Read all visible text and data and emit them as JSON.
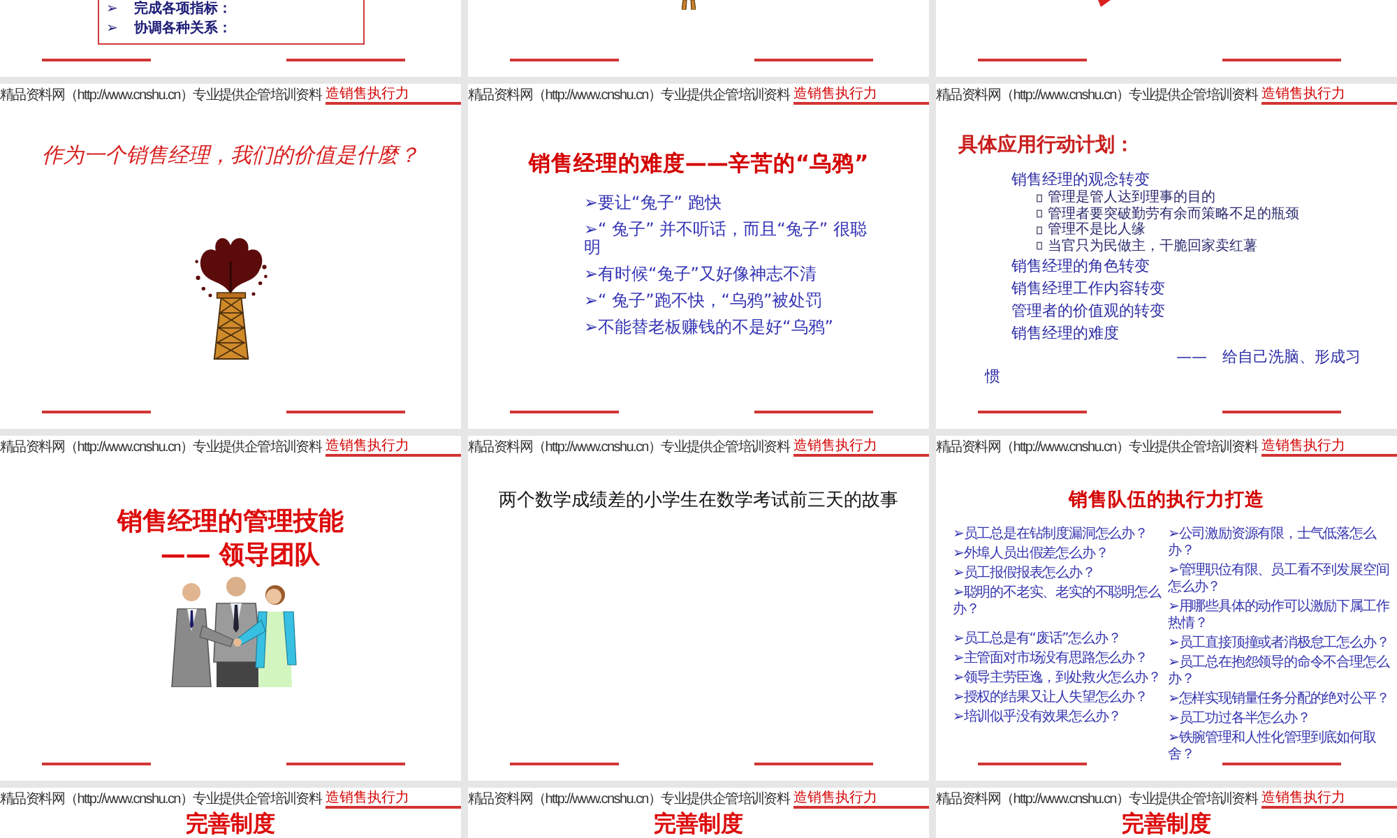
{
  "rows": [
    {
      "slides": [
        {
          "kind": "boxed-list",
          "items": [
            {
              "bullet": "➢",
              "text": "完成各项指标："
            },
            {
              "bullet": "➢",
              "text": "协调各种关系："
            }
          ]
        },
        {
          "kind": "tower-fragment"
        },
        {
          "kind": "arrow-fragment"
        }
      ]
    },
    {
      "slides": [
        {
          "kind": "question",
          "header": {
            "site": "精品资料网（http://www.cnshu.cn）专业提供企管培训资料",
            "topic": "造销售执行力"
          },
          "title": "作为一个销售经理，我们的价值是什麼？"
        },
        {
          "kind": "bullets",
          "header": {
            "site": "精品资料网（http://www.cnshu.cn）专业提供企管培训资料",
            "topic": "造销售执行力"
          },
          "title": "销售经理的难度——辛苦的“乌鸦”",
          "items": [
            "➢要让“兔子” 跑快",
            "➢“ 兔子” 并不听话，而且“兔子” 很聪明",
            "➢有时候“兔子”又好像神志不清",
            "➢“ 兔子”跑不快，“乌鸦”被处罚",
            "➢不能替老板赚钱的不是好“乌鸦”"
          ]
        },
        {
          "kind": "plan",
          "header": {
            "site": "精品资料网（http://www.cnshu.cn）专业提供企管培训资料",
            "topic": "造销售执行力"
          },
          "title": "具体应用行动计划：",
          "items": [
            {
              "text": "销售经理的观念转变",
              "children": [
                {
                  "text": "管理是管人达到理事的目的"
                },
                {
                  "text": "管理者要突破勤劳有余而策略不足的瓶颈"
                },
                {
                  "text": "管理不是比人缘"
                },
                {
                  "text": "当官只为民做主，干脆回家卖红薯"
                }
              ]
            },
            {
              "text": "销售经理的角色转变"
            },
            {
              "text": "销售经理工作内容转变"
            },
            {
              "text": "管理者的价值观的转变"
            },
            {
              "text": "销售经理的难度"
            }
          ],
          "conclusion": "——　给自己洗脑、形成习惯"
        }
      ]
    },
    {
      "slides": [
        {
          "kind": "title-picture",
          "header": {
            "site": "精品资料网（http://www.cnshu.cn）专业提供企管培训资料",
            "topic": "造销售执行力"
          },
          "title_lines": [
            "销售经理的管理技能",
            "—— 领导团队"
          ]
        },
        {
          "kind": "story",
          "header": {
            "site": "精品资料网（http://www.cnshu.cn）专业提供企管培训资料",
            "topic": "造销售执行力"
          },
          "title": "两个数学成绩差的小学生在数学考试前三天的故事"
        },
        {
          "kind": "two-column",
          "header": {
            "site": "精品资料网（http://www.cnshu.cn）专业提供企管培训资料",
            "topic": "造销售执行力"
          },
          "title": "销售队伍的执行力打造",
          "columns": [
            {
              "groups": [
                {
                  "items": [
                    "➢员工总是在钻制度漏洞怎么办？",
                    "➢外埠人员出假差怎么办？",
                    "➢员工报假报表怎么办？",
                    "➢聪明的不老实、老实的不聪明怎么办？"
                  ]
                },
                {
                  "items": [
                    "➢员工总是有“废话”怎么办？",
                    "➢主管面对市场没有思路怎么办？",
                    "➢领导主劳臣逸，到处救火怎么办？",
                    "➢授权的结果又让人失望怎么办？",
                    "➢培训似乎没有效果怎么办？"
                  ]
                }
              ]
            },
            {
              "groups": [
                {
                  "items": [
                    "➢公司激励资源有限，士气低落怎么办？",
                    "➢管理职位有限、员工看不到发展空间怎么办？",
                    "➢用哪些具体的动作可以激励下属工作热情？",
                    "➢员工直接顶撞或者消极怠工怎么办？",
                    "➢员工总在抱怨领导的命令不合理怎么办？",
                    "➢怎样实现销量任务分配的绝对公平？",
                    "➢员工功过各半怎么办？",
                    "➢铁腕管理和人性化管理到底如何取舍？"
                  ]
                }
              ]
            }
          ]
        }
      ]
    },
    {
      "slides": [
        {
          "kind": "title",
          "header": {
            "site": "精品资料网（http://www.cnshu.cn）专业提供企管培训资料",
            "topic": "造销售执行力"
          },
          "title": "完善制度"
        },
        {
          "kind": "title",
          "header": {
            "site": "精品资料网（http://www.cnshu.cn）专业提供企管培训资料",
            "topic": "造销售执行力"
          },
          "title": "完善制度"
        },
        {
          "kind": "title",
          "header": {
            "site": "精品资料网（http://www.cnshu.cn）专业提供企管培训资料",
            "topic": "造销售执行力"
          },
          "title": "完善制度"
        }
      ]
    }
  ]
}
